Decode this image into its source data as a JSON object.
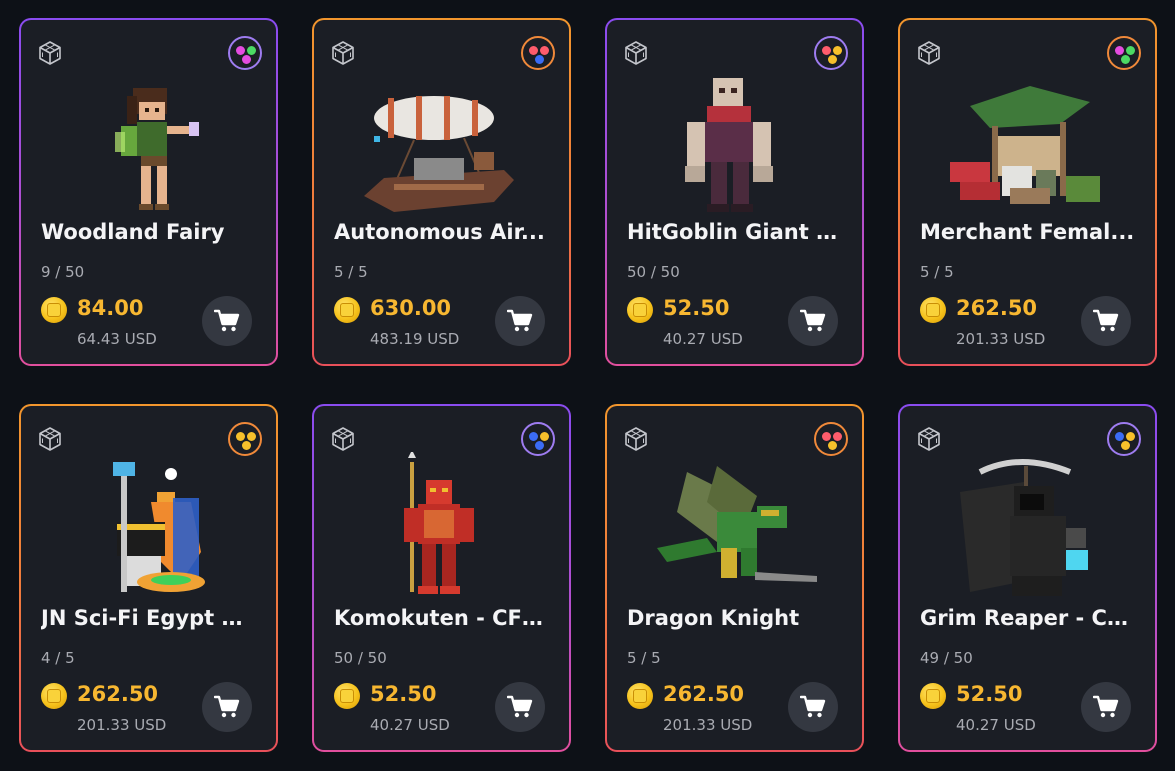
{
  "colors": {
    "background": "#0d1117",
    "card": "#1b1e25",
    "price": "#f7b731",
    "muted": "#a9abb2",
    "border_purple": "#8a4cf0",
    "border_orange": "#f2962d"
  },
  "items": [
    {
      "title": "Woodland Fairy",
      "stock": "9 / 50",
      "price": "84.00",
      "usd": "64.43 USD",
      "border": "purple",
      "badge_dots": [
        "#e44ce0",
        "#4cd964",
        "#e44ce0"
      ],
      "art": "fairy"
    },
    {
      "title": "Autonomous Air...",
      "stock": "5 / 5",
      "price": "630.00",
      "usd": "483.19 USD",
      "border": "orange",
      "badge_dots": [
        "#ff5c6c",
        "#ff5c6c",
        "#3b6cf5"
      ],
      "art": "airship"
    },
    {
      "title": "HitGoblin Giant - ...",
      "stock": "50 / 50",
      "price": "52.50",
      "usd": "40.27 USD",
      "border": "purple",
      "badge_dots": [
        "#ff5c6c",
        "#f7c02b",
        "#f7c02b"
      ],
      "art": "giant"
    },
    {
      "title": "Merchant Femal...",
      "stock": "5 / 5",
      "price": "262.50",
      "usd": "201.33 USD",
      "border": "orange",
      "badge_dots": [
        "#e44ce0",
        "#4cd964",
        "#4cd964"
      ],
      "art": "merchant"
    },
    {
      "title": "JN Sci-Fi Egypt C...",
      "stock": "4 / 5",
      "price": "262.50",
      "usd": "201.33 USD",
      "border": "orange",
      "badge_dots": [
        "#f7c02b",
        "#f7c02b",
        "#f7c02b"
      ],
      "art": "egypt"
    },
    {
      "title": "Komokuten - CF ...",
      "stock": "50 / 50",
      "price": "52.50",
      "usd": "40.27 USD",
      "border": "purple",
      "badge_dots": [
        "#3b6cf5",
        "#f7c02b",
        "#3b6cf5"
      ],
      "art": "warrior"
    },
    {
      "title": "Dragon Knight",
      "stock": "5 / 5",
      "price": "262.50",
      "usd": "201.33 USD",
      "border": "orange",
      "badge_dots": [
        "#ff5c6c",
        "#ff5c6c",
        "#f7c02b"
      ],
      "art": "dragon"
    },
    {
      "title": "Grim Reaper - CF...",
      "stock": "49 / 50",
      "price": "52.50",
      "usd": "40.27 USD",
      "border": "purple",
      "badge_dots": [
        "#3b6cf5",
        "#f7c02b",
        "#f7c02b"
      ],
      "art": "reaper"
    }
  ]
}
